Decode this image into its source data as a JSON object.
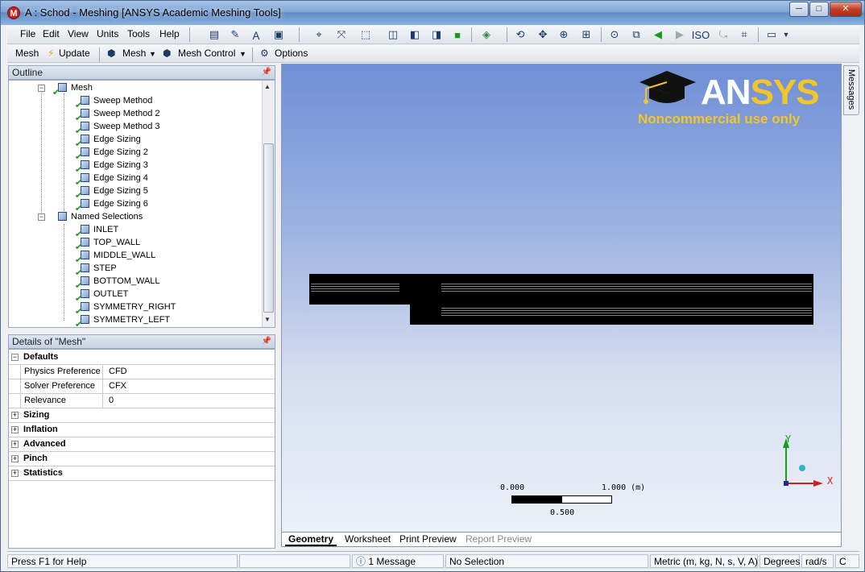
{
  "window": {
    "title": "A : Schod - Meshing [ANSYS Academic Meshing Tools]",
    "icon_letter": "M",
    "controls": {
      "minimize": "─",
      "maximize": "□",
      "close": "✕"
    }
  },
  "menubar": {
    "items": [
      "File",
      "Edit",
      "View",
      "Units",
      "Tools",
      "Help"
    ]
  },
  "toolbar2": {
    "mesh_label": "Mesh",
    "update_label": "Update",
    "mesh_menu_label": "Mesh",
    "mesh_control_label": "Mesh Control",
    "options_label": "Options"
  },
  "outline": {
    "title": "Outline",
    "mesh_node": "Mesh",
    "mesh_children": [
      "Sweep Method",
      "Sweep Method 2",
      "Sweep Method 3",
      "Edge Sizing",
      "Edge Sizing 2",
      "Edge Sizing 3",
      "Edge Sizing 4",
      "Edge Sizing 5",
      "Edge Sizing 6"
    ],
    "named_selections_node": "Named Selections",
    "named_children": [
      "INLET",
      "TOP_WALL",
      "MIDDLE_WALL",
      "STEP",
      "BOTTOM_WALL",
      "OUTLET",
      "SYMMETRY_RIGHT",
      "SYMMETRY_LEFT"
    ]
  },
  "details": {
    "title": "Details of \"Mesh\"",
    "defaults_group": "Defaults",
    "rows": [
      {
        "key": "Physics Preference",
        "value": "CFD"
      },
      {
        "key": "Solver Preference",
        "value": "CFX"
      },
      {
        "key": "Relevance",
        "value": "0"
      }
    ],
    "collapsed_groups": [
      "Sizing",
      "Inflation",
      "Advanced",
      "Pinch",
      "Statistics"
    ]
  },
  "viewport": {
    "logo_a": "AN",
    "logo_b": "SYS",
    "logo_sub": "Noncommercial use only",
    "scale": {
      "left": "0.000",
      "right": "1.000 (m)",
      "mid": "0.500"
    },
    "axis_y": "Y",
    "axis_x": "X",
    "tabs": [
      "Geometry",
      "Worksheet",
      "Print Preview",
      "Report Preview"
    ]
  },
  "side_tab": "Messages",
  "statusbar": {
    "help": "Press F1 for Help",
    "messages": "1 Message",
    "selection": "No Selection",
    "units": "Metric (m, kg, N, s, V, A)",
    "angle": "Degrees",
    "rate": "rad/s",
    "extra": "C"
  },
  "colors": {
    "brand_gold": "#f2c52a",
    "check_green": "#1a9a1a",
    "axis_y": "#1a9a1a",
    "axis_x": "#d02020"
  }
}
